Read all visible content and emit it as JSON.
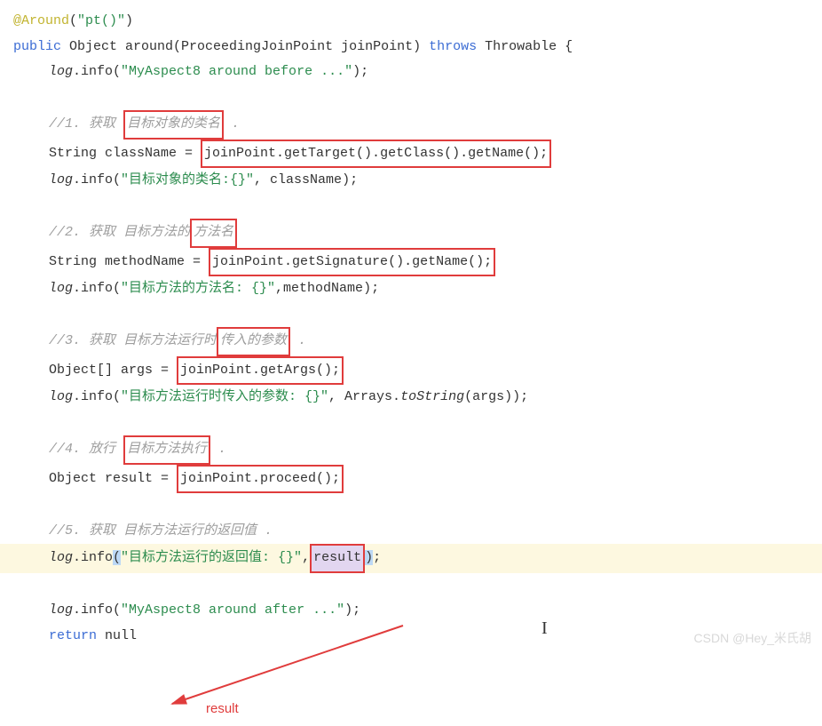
{
  "code": {
    "l1_ann": "@Around",
    "l1_paren": "(",
    "l1_str": "\"pt()\"",
    "l1_close": ")",
    "l2_kw1": "public",
    "l2_type": " Object ",
    "l2_name": "around",
    "l2_paren": "(ProceedingJoinPoint joinPoint) ",
    "l2_kw2": "throws",
    "l2_rest": " Throwable {",
    "l3_field": "log",
    "l3_call": ".info(",
    "l3_str": "\"MyAspect8 around before ...\"",
    "l3_end": ");",
    "c1_a": "//1. 获取 ",
    "c1_b": "目标对象的类名",
    "c1_c": " .",
    "l5_a": "String className = ",
    "l5_b": "joinPoint.getTarget().getClass().getName();",
    "l6_a": "log",
    "l6_b": ".info(",
    "l6_c": "\"目标对象的类名:{}\"",
    "l6_d": ", className);",
    "c2_a": "//2. 获取 目标方法的",
    "c2_b": "方法名",
    "l8_a": "String methodName = ",
    "l8_b": "joinPoint.getSignature().getName();",
    "l9_a": "log",
    "l9_b": ".info(",
    "l9_c": "\"目标方法的方法名: {}\"",
    "l9_d": ",methodName);",
    "c3_a": "//3. 获取 目标方法运行时",
    "c3_b": "传入的参数",
    "c3_c": " .",
    "l11_a": "Object[] args = ",
    "l11_b": "joinPoint.getArgs();",
    "l12_a": "log",
    "l12_b": ".info(",
    "l12_c": "\"目标方法运行时传入的参数: {}\"",
    "l12_d": ", Arrays.",
    "l12_e": "toString",
    "l12_f": "(args));",
    "c4_a": "//4. 放行 ",
    "c4_b": "目标方法执行",
    "c4_c": " .",
    "l14_a": "Object result = ",
    "l14_b": "joinPoint.proceed();",
    "c5": "//5. 获取 目标方法运行的返回值 .",
    "l16_a": "log",
    "l16_b": ".info",
    "l16_p1": "(",
    "l16_c": "\"目标方法运行的返回值: {}\"",
    "l16_d": ",",
    "l16_e": "result",
    "l16_p2": ")",
    "l16_f": ";",
    "l17_a": "log",
    "l17_b": ".info(",
    "l17_c": "\"MyAspect8 around after ...\"",
    "l17_d": ");",
    "l18_a": "return",
    "l18_b": " null"
  },
  "annotation": {
    "label": "result"
  },
  "watermark": "CSDN @Hey_米氏胡"
}
